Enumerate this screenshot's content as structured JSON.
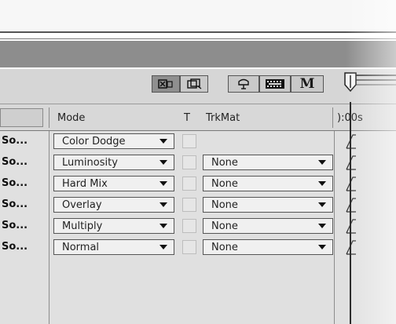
{
  "toolbar": {
    "buttons": [
      {
        "icon": "motion-blur-icon",
        "pressed": true
      },
      {
        "icon": "frame-blending-icon",
        "pressed": false
      },
      {
        "icon": "draft-3d-icon",
        "pressed": false
      },
      {
        "icon": "film-strip-icon",
        "pressed": false
      },
      {
        "icon": "M",
        "pressed": false
      }
    ]
  },
  "header": {
    "mode": "Mode",
    "t": "T",
    "trkmat": "TrkMat",
    "time": "):00s"
  },
  "rows": [
    {
      "source": "So...",
      "mode": "Color Dodge",
      "trkmat": ""
    },
    {
      "source": "So...",
      "mode": "Luminosity",
      "trkmat": "None"
    },
    {
      "source": "So...",
      "mode": "Hard Mix",
      "trkmat": "None"
    },
    {
      "source": "So...",
      "mode": "Overlay",
      "trkmat": "None"
    },
    {
      "source": "So...",
      "mode": "Multiply",
      "trkmat": "None"
    },
    {
      "source": "So...",
      "mode": "Normal",
      "trkmat": "None"
    }
  ]
}
